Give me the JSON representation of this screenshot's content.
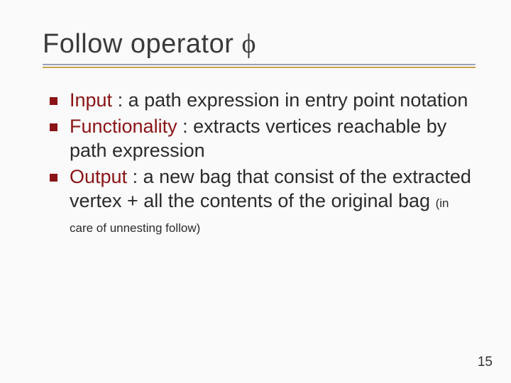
{
  "title_main": "Follow operator ",
  "title_symbol": "ϕ",
  "bullets": [
    {
      "term": "Input",
      "text": " : a path expression in entry point notation"
    },
    {
      "term": "Functionality",
      "text": " : extracts vertices reachable by path expression"
    },
    {
      "term": "Output",
      "text": " : a new bag that consist of the extracted vertex + all the contents of the original bag ",
      "tail_small": "(in care of unnesting follow)"
    }
  ],
  "page_number": "15"
}
